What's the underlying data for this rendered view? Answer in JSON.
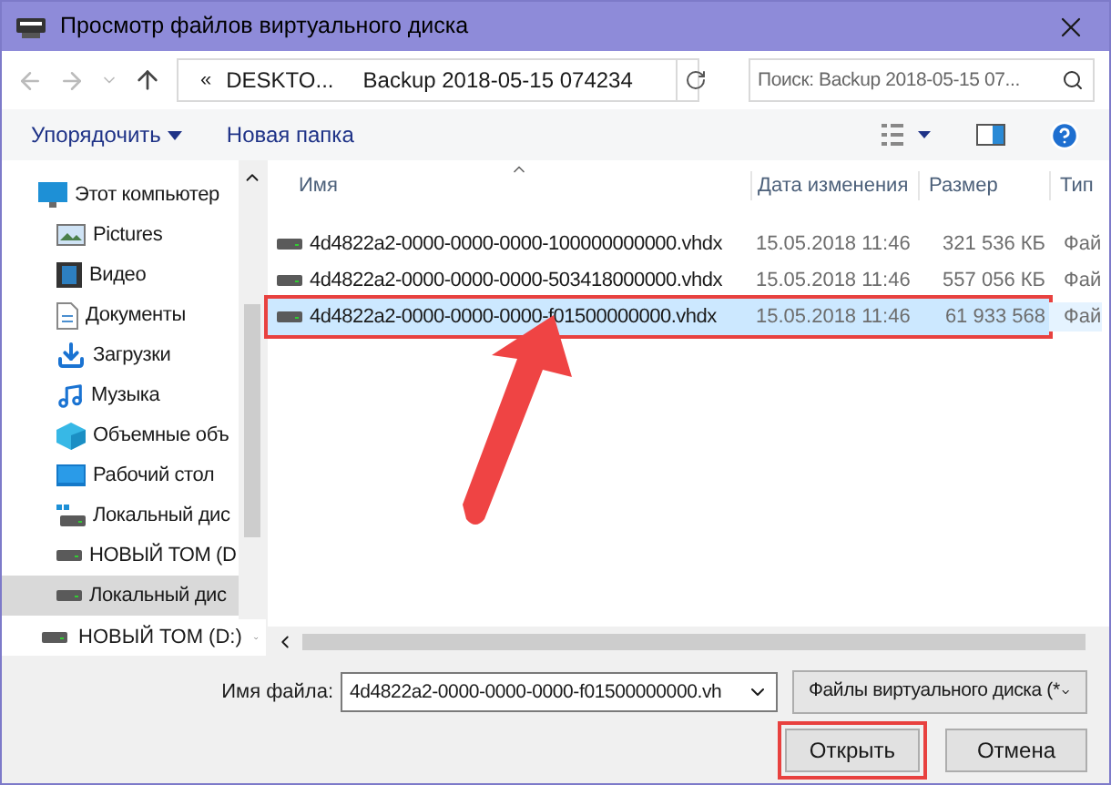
{
  "window": {
    "title": "Просмотр файлов виртуального диска"
  },
  "address": {
    "prefix": "«",
    "crumbs": [
      "DESKTO...",
      "Backup 2018-05-15 074234"
    ]
  },
  "search": {
    "placeholder": "Поиск: Backup 2018-05-15 07..."
  },
  "toolbar": {
    "organize": "Упорядочить",
    "new_folder": "Новая папка"
  },
  "sidebar": {
    "items": [
      {
        "label": "Этот компьютер",
        "kind": "pc",
        "selected": false
      },
      {
        "label": "Pictures",
        "kind": "pictures",
        "selected": false
      },
      {
        "label": "Видео",
        "kind": "video",
        "selected": false
      },
      {
        "label": "Документы",
        "kind": "docs",
        "selected": false
      },
      {
        "label": "Загрузки",
        "kind": "downloads",
        "selected": false
      },
      {
        "label": "Музыка",
        "kind": "music",
        "selected": false
      },
      {
        "label": "Объемные объ",
        "kind": "objects",
        "selected": false
      },
      {
        "label": "Рабочий стол",
        "kind": "desktop",
        "selected": false
      },
      {
        "label": "Локальный дис",
        "kind": "sysdrive",
        "selected": false
      },
      {
        "label": "НОВЫЙ ТОМ (D",
        "kind": "drive",
        "selected": false
      },
      {
        "label": "Локальный дис",
        "kind": "drive",
        "selected": true
      },
      {
        "label": "НОВЫЙ ТОМ (D:)",
        "kind": "drive",
        "selected": false
      }
    ]
  },
  "table": {
    "columns": [
      "Имя",
      "Дата изменения",
      "Размер",
      "Тип"
    ],
    "rows": [
      {
        "name": "4d4822a2-0000-0000-0000-100000000000.vhdx",
        "date": "15.05.2018 11:46",
        "size": "321 536 КБ",
        "type": "Фай",
        "selected": false
      },
      {
        "name": "4d4822a2-0000-0000-0000-503418000000.vhdx",
        "date": "15.05.2018 11:46",
        "size": "557 056 КБ",
        "type": "Фай",
        "selected": false
      },
      {
        "name": "4d4822a2-0000-0000-0000-f01500000000.vhdx",
        "date": "15.05.2018 11:46",
        "size": "61 933 568",
        "type": "Фай",
        "selected": true
      }
    ]
  },
  "footer": {
    "filename_label": "Имя файла:",
    "filename": "4d4822a2-0000-0000-0000-f01500000000.vh",
    "filter": "Файлы виртуального диска (*",
    "open": "Открыть",
    "cancel": "Отмена"
  }
}
